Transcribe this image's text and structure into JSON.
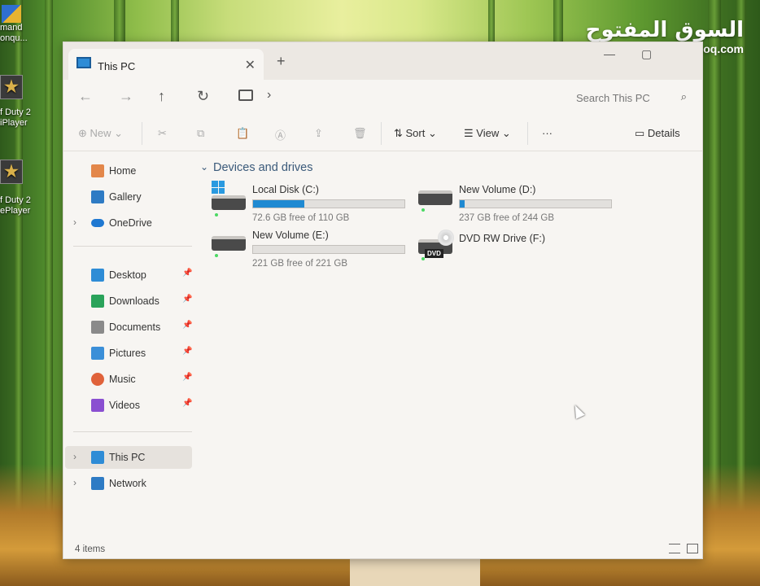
{
  "desktop": {
    "icons": [
      {
        "label_lines": [
          "mand",
          "onqu..."
        ],
        "icon": "shield-icon"
      },
      {
        "label_lines": [
          "f Duty 2",
          "iPlayer"
        ],
        "icon": "cod2-icon"
      },
      {
        "label_lines": [
          "f Duty 2",
          "ePlayer"
        ],
        "icon": "cod2-icon"
      }
    ],
    "watermark": {
      "arabic": "السوق المفتوح",
      "latin": "opensooq.com"
    }
  },
  "window": {
    "tab_title": "This PC",
    "new_tab_symbol": "+",
    "search_placeholder": "Search This PC",
    "toolbar": {
      "new_label": "New",
      "sort_label": "Sort",
      "view_label": "View",
      "more_label": "···",
      "details_label": "Details"
    },
    "sidebar": {
      "quick": [
        {
          "label": "Home",
          "icon": "home-icon",
          "color": "#e3874a"
        },
        {
          "label": "Gallery",
          "icon": "gallery-icon",
          "color": "#2e7bc4"
        },
        {
          "label": "OneDrive",
          "icon": "onedrive-icon",
          "color": "#1f78d1"
        }
      ],
      "pinned": [
        {
          "label": "Desktop",
          "icon": "desktop-icon",
          "color": "#2e8cd6"
        },
        {
          "label": "Downloads",
          "icon": "downloads-icon",
          "color": "#2aa35a"
        },
        {
          "label": "Documents",
          "icon": "documents-icon",
          "color": "#8a8a8a"
        },
        {
          "label": "Pictures",
          "icon": "pictures-icon",
          "color": "#3b8fd8"
        },
        {
          "label": "Music",
          "icon": "music-icon",
          "color": "#e0623a"
        },
        {
          "label": "Videos",
          "icon": "videos-icon",
          "color": "#8a4fd1"
        }
      ],
      "locations": [
        {
          "label": "This PC",
          "icon": "this-pc-icon",
          "color": "#2e8cd6"
        },
        {
          "label": "Network",
          "icon": "network-icon",
          "color": "#2e7bc4"
        }
      ]
    },
    "section_title": "Devices and drives",
    "drives": [
      {
        "name": "Local Disk (C:)",
        "free_text": "72.6 GB free of 110 GB",
        "used_fraction": 0.34
      },
      {
        "name": "New Volume (D:)",
        "free_text": "237 GB free of 244 GB",
        "used_fraction": 0.03
      },
      {
        "name": "New Volume (E:)",
        "free_text": "221 GB free of 221 GB",
        "used_fraction": 0.0
      },
      {
        "name": "DVD RW Drive (F:)",
        "free_text": "",
        "dvd_label": "DVD"
      }
    ],
    "status_text": "4 items"
  }
}
